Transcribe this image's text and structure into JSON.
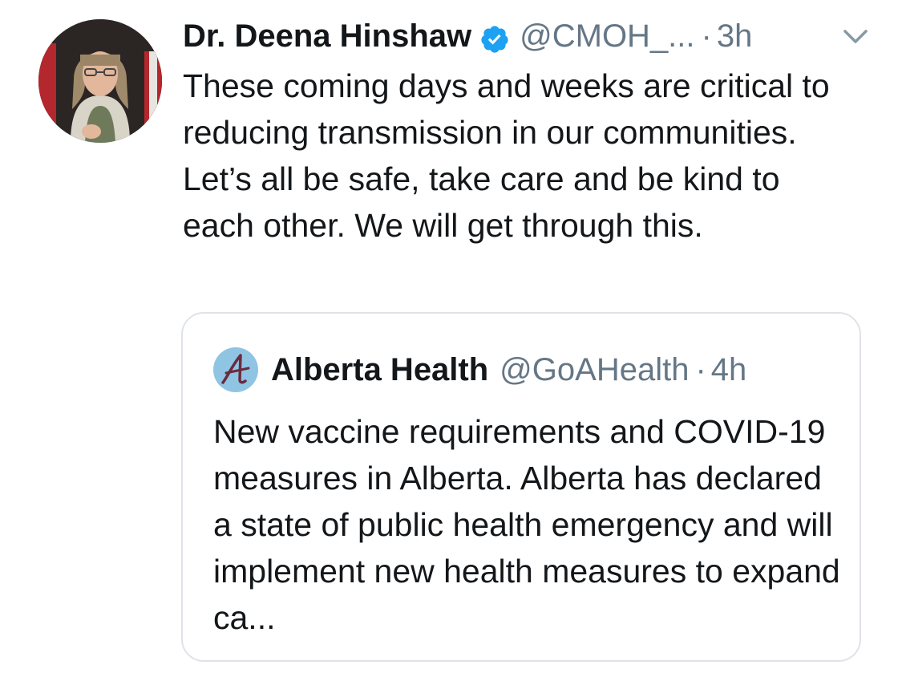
{
  "tweet": {
    "author_name": "Dr. Deena Hinshaw",
    "handle": "@CMOH_...",
    "time": "3h",
    "separator": "·",
    "text": "These coming days and weeks are critical to reducing transmission in our communities. Let’s all be safe, take care and be kind to each other. We will get through this."
  },
  "quoted": {
    "author_name": "Alberta Health",
    "handle": "@GoAHealth",
    "separator": "·",
    "time": "4h",
    "text": "New vaccine requirements and COVID-19 measures in Alberta. Alberta has declared a state of public health emergency and will implement new health measures to expand ca..."
  },
  "icons": {
    "verified": "verified-badge-icon",
    "caret": "chevron-down-icon",
    "quoted_logo": "alberta-logo"
  },
  "colors": {
    "text": "#14171a",
    "muted": "#657786",
    "verified_blue": "#1da1f2",
    "border": "#dfe3e7",
    "logo_bg": "#8fc4e3",
    "logo_mark": "#6b2a3f"
  }
}
